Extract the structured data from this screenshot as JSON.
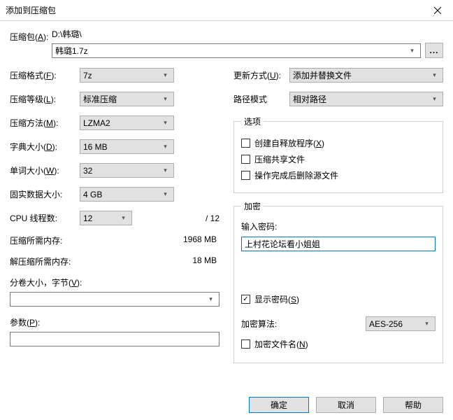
{
  "title": "添加到压缩包",
  "archive": {
    "label": "压缩包(A):",
    "path": "D:\\韩璐\\",
    "name": "韩璐1.7z",
    "browse": "..."
  },
  "left": {
    "format_label": "压缩格式(F):",
    "format_value": "7z",
    "level_label": "压缩等级(L):",
    "level_value": "标准压缩",
    "method_label": "压缩方法(M):",
    "method_value": "LZMA2",
    "dict_label": "字典大小(D):",
    "dict_value": "16 MB",
    "word_label": "单词大小(W):",
    "word_value": "32",
    "solid_label": "固实数据大小:",
    "solid_value": "4 GB",
    "threads_label": "CPU 线程数:",
    "threads_value": "12",
    "threads_max": "/ 12",
    "mem_compress_label": "压缩所需内存:",
    "mem_compress_value": "1968 MB",
    "mem_decompress_label": "解压缩所需内存:",
    "mem_decompress_value": "18 MB",
    "split_label": "分卷大小，字节(V):",
    "params_label": "参数(P):"
  },
  "right": {
    "update_label": "更新方式(U):",
    "update_value": "添加并替换文件",
    "pathmode_label": "路径模式",
    "pathmode_value": "相对路径",
    "options_legend": "选项",
    "sfx_label": "创建自释放程序(X)",
    "shared_label": "压缩共享文件",
    "delete_src_label": "操作完成后删除源文件",
    "encrypt_legend": "加密",
    "pwd_label": "输入密码:",
    "pwd_value": "上村花论坛看小姐姐",
    "show_pwd_label": "显示密码(S)",
    "algo_label": "加密算法:",
    "algo_value": "AES-256",
    "encrypt_names_label": "加密文件名(N)"
  },
  "footer": {
    "ok": "确定",
    "cancel": "取消",
    "help": "帮助"
  }
}
